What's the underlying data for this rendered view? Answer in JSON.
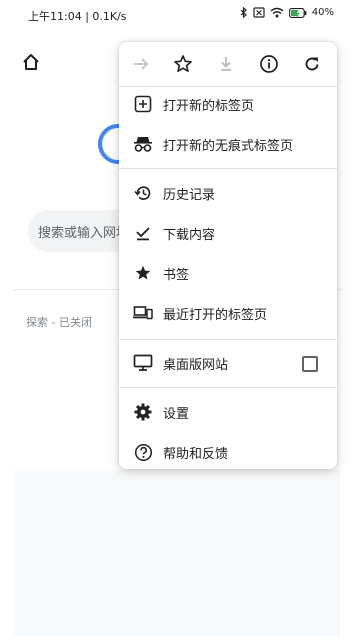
{
  "status_bar": {
    "time_speed": "上午11:04 | 0.1K/s",
    "battery": "40"
  },
  "background": {
    "search_placeholder": "搜索或输入网址",
    "explore_label": "探索 - 已关闭"
  },
  "menu": {
    "toolbar": {
      "forward_icon": "forward-arrow-icon",
      "bookmark_icon": "star-outline-icon",
      "download_icon": "download-icon",
      "info_icon": "info-icon",
      "refresh_icon": "refresh-icon"
    },
    "items": {
      "new_tab": "打开新的标签页",
      "incognito": "打开新的无痕式标签页",
      "history": "历史记录",
      "downloads": "下载内容",
      "bookmarks": "书签",
      "recent_tabs": "最近打开的标签页",
      "desktop_site": "桌面版网站",
      "settings": "设置",
      "help": "帮助和反馈"
    },
    "desktop_site_checked": false
  },
  "colors": {
    "icon_gray": "#5f6368",
    "icon_dark": "#202124",
    "google_blue": "#4285f4"
  }
}
